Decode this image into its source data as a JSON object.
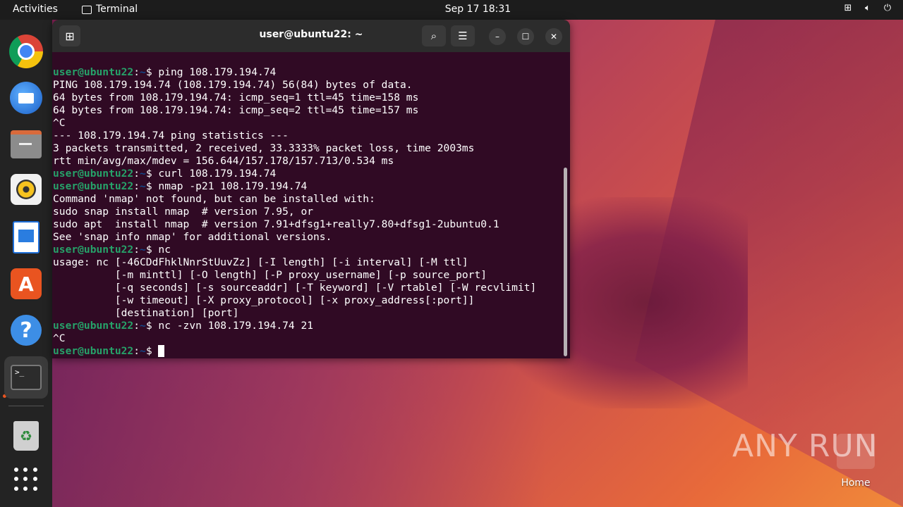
{
  "topbar": {
    "activities": "Activities",
    "app_name": "Terminal",
    "clock": "Sep 17  18:31",
    "tray": [
      "network-icon",
      "volume-icon",
      "power-icon"
    ]
  },
  "dock": {
    "items": [
      "Google Chrome",
      "Thunderbird",
      "Files",
      "Rhythmbox",
      "LibreOffice Writer",
      "Ubuntu Software",
      "Help",
      "Terminal",
      "Trash",
      "Show Applications"
    ]
  },
  "terminal": {
    "title": "user@ubuntu22: ~",
    "prompt_user": "user@ubuntu22",
    "prompt_sep": ":",
    "prompt_cwd": "~",
    "prompt_sym": "$ ",
    "lines": [
      {
        "prompt": true,
        "text": "ping 108.179.194.74"
      },
      {
        "prompt": false,
        "text": "PING 108.179.194.74 (108.179.194.74) 56(84) bytes of data."
      },
      {
        "prompt": false,
        "text": "64 bytes from 108.179.194.74: icmp_seq=1 ttl=45 time=158 ms"
      },
      {
        "prompt": false,
        "text": "64 bytes from 108.179.194.74: icmp_seq=2 ttl=45 time=157 ms"
      },
      {
        "prompt": false,
        "text": "^C"
      },
      {
        "prompt": false,
        "text": "--- 108.179.194.74 ping statistics ---"
      },
      {
        "prompt": false,
        "text": "3 packets transmitted, 2 received, 33.3333% packet loss, time 2003ms"
      },
      {
        "prompt": false,
        "text": "rtt min/avg/max/mdev = 156.644/157.178/157.713/0.534 ms"
      },
      {
        "prompt": true,
        "text": "curl 108.179.194.74"
      },
      {
        "prompt": true,
        "text": "nmap -p21 108.179.194.74"
      },
      {
        "prompt": false,
        "text": "Command 'nmap' not found, but can be installed with:"
      },
      {
        "prompt": false,
        "text": "sudo snap install nmap  # version 7.95, or"
      },
      {
        "prompt": false,
        "text": "sudo apt  install nmap  # version 7.91+dfsg1+really7.80+dfsg1-2ubuntu0.1"
      },
      {
        "prompt": false,
        "text": "See 'snap info nmap' for additional versions."
      },
      {
        "prompt": true,
        "text": "nc"
      },
      {
        "prompt": false,
        "text": "usage: nc [-46CDdFhklNnrStUuvZz] [-I length] [-i interval] [-M ttl]"
      },
      {
        "prompt": false,
        "text": "          [-m minttl] [-O length] [-P proxy_username] [-p source_port]"
      },
      {
        "prompt": false,
        "text": "          [-q seconds] [-s sourceaddr] [-T keyword] [-V rtable] [-W recvlimit]"
      },
      {
        "prompt": false,
        "text": "          [-w timeout] [-X proxy_protocol] [-x proxy_address[:port]]"
      },
      {
        "prompt": false,
        "text": "          [destination] [port]"
      },
      {
        "prompt": true,
        "text": "nc -zvn 108.179.194.74 21"
      },
      {
        "prompt": false,
        "text": "^C"
      },
      {
        "prompt": true,
        "text": "",
        "cursor": true
      }
    ]
  },
  "desktop": {
    "watermark": "ANY RUN",
    "home_label": "Home"
  },
  "colors": {
    "terminal_bg": "#300a24",
    "prompt_green": "#26a269",
    "ubuntu_orange": "#e95420",
    "topbar_bg": "#1c1c1c"
  }
}
